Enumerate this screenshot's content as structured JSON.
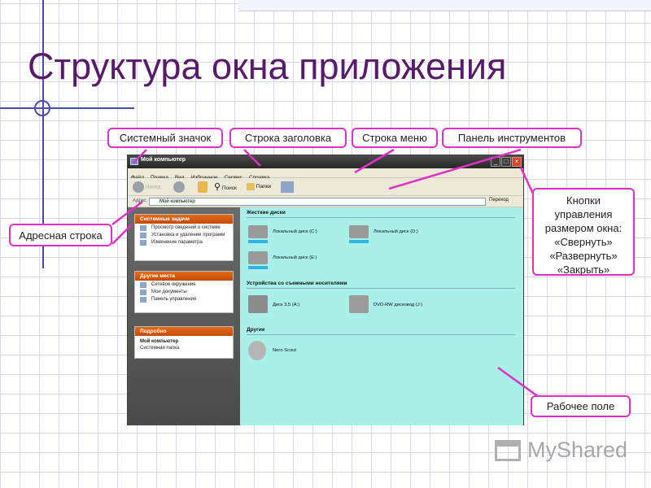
{
  "slide": {
    "title": "Структура окна приложения"
  },
  "callouts": {
    "system_icon": "Системный значок",
    "title_bar": "Строка заголовка",
    "menu_bar": "Строка меню",
    "toolbar": "Панель инструментов",
    "address_bar": "Адресная строка",
    "window_buttons": [
      "Кнопки",
      "управления",
      "размером окна:",
      "«Свернуть»",
      "«Развернуть»",
      "«Закрыть»"
    ],
    "workspace": "Рабочее поле"
  },
  "window": {
    "title": "Мой компьютер",
    "menu": [
      "Файл",
      "Правка",
      "Вид",
      "Избранное",
      "Сервис",
      "Справка"
    ],
    "toolbar": {
      "back": "Назад",
      "search": "Поиск",
      "folders": "Папки"
    },
    "address": {
      "label": "Адрес",
      "value": "Мой компьютер",
      "go": "Переход"
    },
    "left_panels": {
      "tasks": {
        "title": "Системные задачи",
        "items": [
          "Просмотр сведений о системе",
          "Установка и удаление программ",
          "Изменение параметра"
        ]
      },
      "places": {
        "title": "Другие места",
        "items": [
          "Сетевое окружение",
          "Мои документы",
          "Панель управления"
        ]
      },
      "details": {
        "title": "Подробно",
        "name": "Мой компьютер",
        "desc": "Системная папка"
      }
    },
    "groups": {
      "hard_disks": {
        "title": "Жесткие диски",
        "items": [
          "Локальный диск (C:)",
          "Локальный диск (D:)",
          "Локальный диск (E:)"
        ]
      },
      "removable": {
        "title": "Устройства со съемными носителями",
        "items": [
          "Диск 3,5 (A:)",
          "DVD-RW дисковод (J:)"
        ]
      },
      "other": {
        "title": "Другие",
        "items": [
          "Nero Scout"
        ]
      }
    }
  },
  "logo": "MyShared",
  "colors": {
    "title": "#5a1a6b",
    "callout_border": "#e030c8",
    "workspace": "#a8f0e8",
    "panel_header": "#d9580f"
  },
  "icons": [
    "crosshair-icon",
    "system-icon",
    "minimize-icon",
    "maximize-icon",
    "close-icon",
    "back-icon",
    "forward-icon",
    "search-icon",
    "folders-icon",
    "hard-disk-icon",
    "floppy-icon",
    "dvd-icon",
    "nero-icon",
    "myshared-logo-icon"
  ]
}
